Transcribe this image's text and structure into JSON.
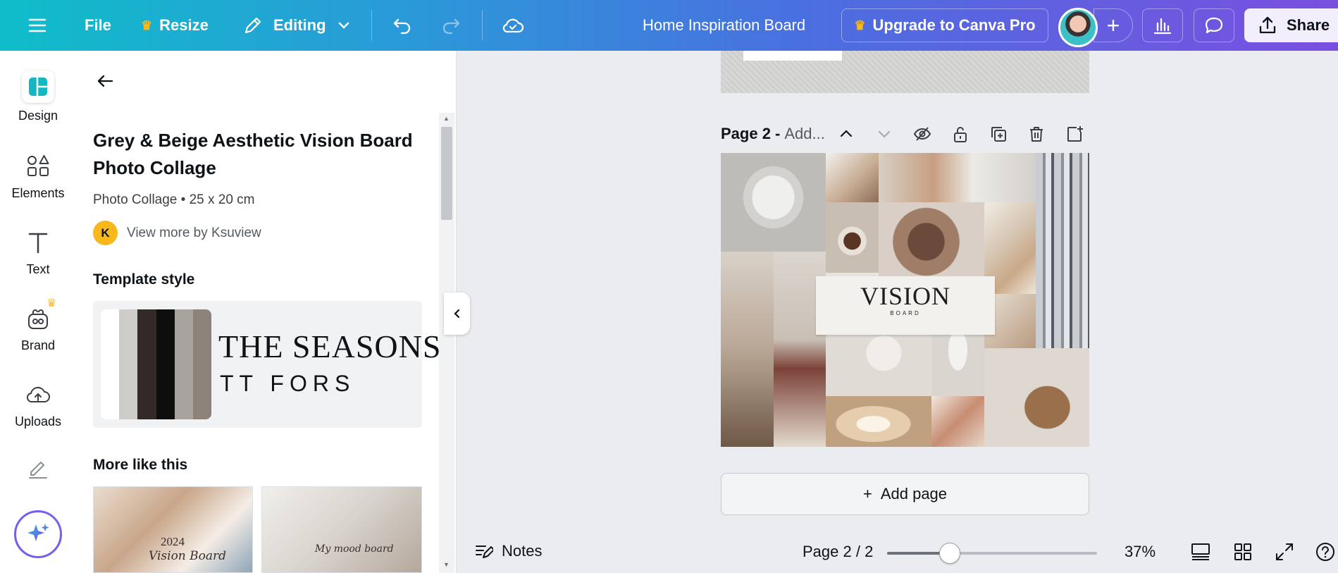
{
  "topbar": {
    "file_label": "File",
    "resize_label": "Resize",
    "editing_label": "Editing",
    "doc_title": "Home Inspiration Board",
    "upgrade_label": "Upgrade to Canva Pro",
    "share_label": "Share",
    "add_label": "+",
    "crown_color": "#f8b81b"
  },
  "rail": {
    "items": [
      {
        "label": "Design",
        "icon": "design-icon"
      },
      {
        "label": "Elements",
        "icon": "shapes-icon"
      },
      {
        "label": "Text",
        "icon": "text-icon"
      },
      {
        "label": "Brand",
        "icon": "brand-icon"
      },
      {
        "label": "Uploads",
        "icon": "cloud-upload-icon"
      },
      {
        "label": "",
        "icon": "draw-icon"
      }
    ]
  },
  "panel": {
    "title": "Grey & Beige Aesthetic Vision Board Photo Collage",
    "meta": "Photo Collage • 25 x 20 cm",
    "author_initial": "K",
    "author_link": "View more by Ksuview",
    "template_style_heading": "Template style",
    "swatch_colors": [
      "#ffffff",
      "#cdccc9",
      "#332a28",
      "#0e0e0e",
      "#a9a39e",
      "#8c8279"
    ],
    "font_preview_1": "THE SEASONS",
    "font_preview_2": "TT FORS",
    "more_heading": "More like this",
    "thumb1_year": "2024",
    "thumb1_text": "Vision Board",
    "thumb2_text": "My mood board"
  },
  "canvas": {
    "page_label": "Page 2 -",
    "page_title_placeholder": "Add...",
    "vision_title": "VISION",
    "vision_subtitle": "BOARD",
    "add_page_label": "Add page",
    "add_page_plus": "+"
  },
  "bottombar": {
    "notes_label": "Notes",
    "page_count": "Page 2 / 2",
    "zoom_value": "37%",
    "zoom_fraction": 0.3
  }
}
